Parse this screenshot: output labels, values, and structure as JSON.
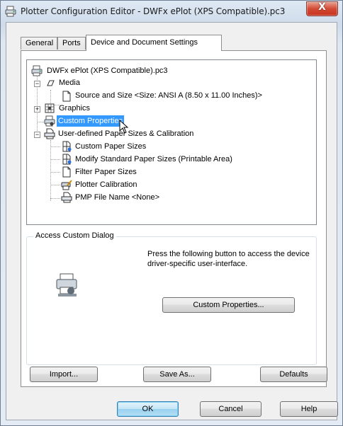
{
  "window": {
    "title": "Plotter Configuration Editor - DWFx ePlot (XPS Compatible).pc3",
    "close_glyph": "X"
  },
  "tabs": [
    {
      "label": "General"
    },
    {
      "label": "Ports"
    },
    {
      "label": "Device and Document Settings",
      "active": true
    }
  ],
  "tree": {
    "root": "DWFx ePlot (XPS Compatible).pc3",
    "media": "Media",
    "source_and_size": "Source and Size <Size: ANSI A (8.50 x 11.00 Inches)>",
    "graphics": "Graphics",
    "custom_properties": "Custom Properties",
    "user_defined": "User-defined Paper Sizes & Calibration",
    "custom_paper_sizes": "Custom Paper Sizes",
    "modify_standard": "Modify Standard Paper Sizes (Printable Area)",
    "filter_paper_sizes": "Filter Paper Sizes",
    "plotter_calibration": "Plotter Calibration",
    "pmp_file_name": "PMP File Name <None>",
    "selected": "custom_properties"
  },
  "access": {
    "group_title": "Access Custom Dialog",
    "description": "Press the following button to access the device driver-specific user-interface.",
    "custom_properties_button": "Custom Properties..."
  },
  "bottom_buttons": {
    "import": "Import...",
    "save_as": "Save As...",
    "defaults": "Defaults"
  },
  "dialog_buttons": {
    "ok": "OK",
    "cancel": "Cancel",
    "help": "Help"
  },
  "colors": {
    "selection": "#3399ff",
    "close_button": "#c7341f"
  },
  "icons": [
    "plotter-icon",
    "media-icon",
    "page-icon",
    "graphics-icon",
    "custom-properties-icon",
    "user-defined-icon",
    "custom-paper-icon",
    "modify-paper-icon",
    "filter-paper-icon",
    "calibration-icon",
    "pmp-file-icon",
    "custom-dialog-icon",
    "close-icon"
  ]
}
